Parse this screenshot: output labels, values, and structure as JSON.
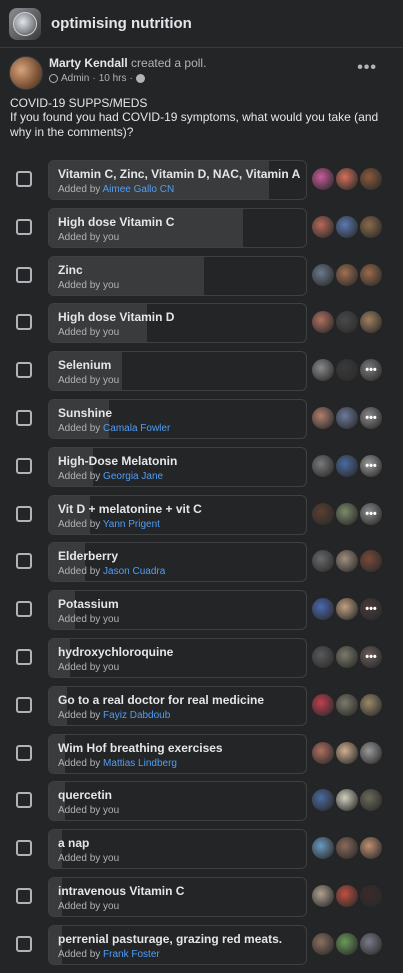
{
  "group": {
    "name": "optimising nutrition",
    "icon": "group-logo-icon"
  },
  "post": {
    "author": "Marty Kendall",
    "action": "created a poll.",
    "role": "Admin",
    "time": "10 hrs",
    "separator": "·",
    "title": "COVID-19 SUPPS/MEDS",
    "question": "If you found you had COVID-19 symptoms, what would you take (and why in the comments)?"
  },
  "poll": {
    "added_by_prefix": "Added by",
    "options": [
      {
        "label": "Vitamin C, Zinc, Vitamin D, NAC, Vitamin A",
        "added_by": "Aimee Gallo CN",
        "is_you": false,
        "fill": 0.85,
        "more": false
      },
      {
        "label": "High dose Vitamin C",
        "added_by": "you",
        "is_you": true,
        "fill": 0.75,
        "more": false
      },
      {
        "label": "Zinc",
        "added_by": "you",
        "is_you": true,
        "fill": 0.6,
        "more": false
      },
      {
        "label": "High dose Vitamin D",
        "added_by": "you",
        "is_you": true,
        "fill": 0.38,
        "more": false
      },
      {
        "label": "Selenium",
        "added_by": "you",
        "is_you": true,
        "fill": 0.28,
        "more": true
      },
      {
        "label": "Sunshine",
        "added_by": "Camala Fowler",
        "is_you": false,
        "fill": 0.23,
        "more": true
      },
      {
        "label": "High-Dose Melatonin",
        "added_by": "Georgia Jane",
        "is_you": false,
        "fill": 0.17,
        "more": true
      },
      {
        "label": "Vit D + melatonine + vit C",
        "added_by": "Yann Prigent",
        "is_you": false,
        "fill": 0.16,
        "more": true
      },
      {
        "label": "Elderberry",
        "added_by": "Jason Cuadra",
        "is_you": false,
        "fill": 0.14,
        "more": false
      },
      {
        "label": "Potassium",
        "added_by": "you",
        "is_you": true,
        "fill": 0.1,
        "more": true
      },
      {
        "label": "hydroxychloroquine",
        "added_by": "you",
        "is_you": true,
        "fill": 0.08,
        "more": true
      },
      {
        "label": "Go to a real doctor for real medicine",
        "added_by": "Fayiz Dabdoub",
        "is_you": false,
        "fill": 0.07,
        "more": false
      },
      {
        "label": "Wim Hof breathing exercises",
        "added_by": "Mattias Lindberg",
        "is_you": false,
        "fill": 0.06,
        "more": false
      },
      {
        "label": "quercetin",
        "added_by": "you",
        "is_you": true,
        "fill": 0.06,
        "more": false
      },
      {
        "label": "a nap",
        "added_by": "you",
        "is_you": true,
        "fill": 0.05,
        "more": false
      },
      {
        "label": "intravenous Vitamin C",
        "added_by": "you",
        "is_you": true,
        "fill": 0.05,
        "more": false
      },
      {
        "label": "perrenial pasturage, grazing red meats.",
        "added_by": "Frank Foster",
        "is_you": false,
        "fill": 0.05,
        "more": false
      }
    ]
  }
}
